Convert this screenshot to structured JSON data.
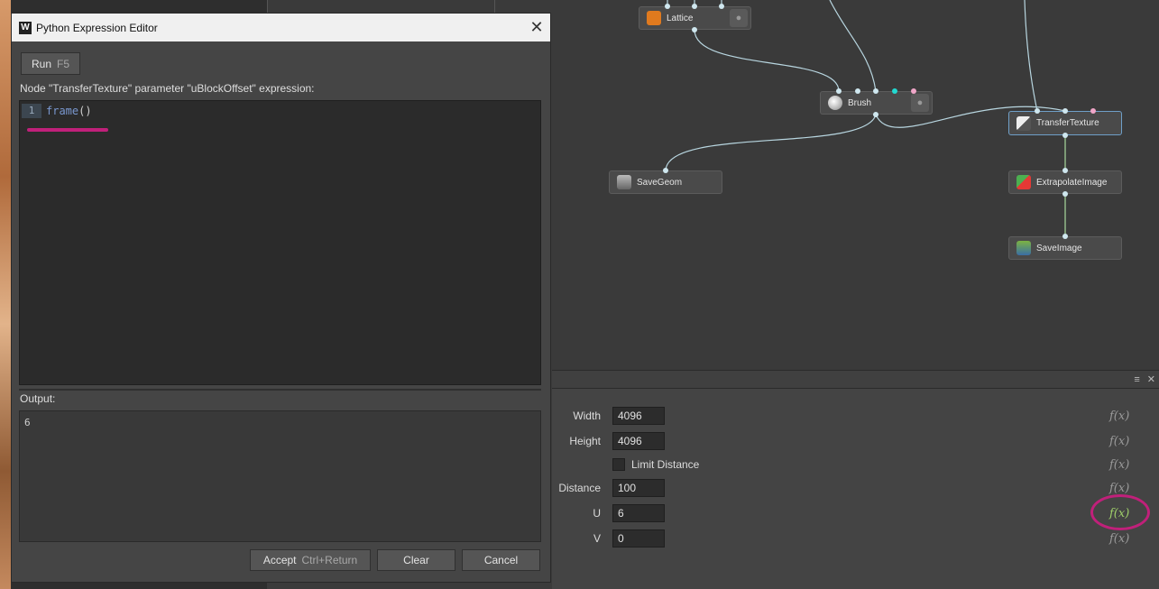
{
  "dialog": {
    "title": "Python Expression Editor",
    "close_glyph": "✕",
    "run_label": "Run",
    "run_shortcut": "F5",
    "expression_label": "Node \"TransferTexture\" parameter \"uBlockOffset\" expression:",
    "line_number": "1",
    "code_func": "frame",
    "code_paren": "()",
    "output_label": "Output:",
    "output_value": "6",
    "accept_label": "Accept",
    "accept_shortcut": "Ctrl+Return",
    "clear_label": "Clear",
    "cancel_label": "Cancel"
  },
  "graph": {
    "nodes": {
      "lattice": "Lattice",
      "brush": "Brush",
      "transfer_texture": "TransferTexture",
      "save_geom": "SaveGeom",
      "extrapolate_image": "ExtrapolateImage",
      "save_image": "SaveImage"
    },
    "bulb_icon": "lightbulb-icon"
  },
  "params": {
    "header_icons": [
      "menu-icon",
      "close-icon"
    ],
    "menu_glyph": "≡",
    "close_glyph": "✕",
    "fx_label": "f(x)",
    "width_label": "Width",
    "width_value": "4096",
    "height_label": "Height",
    "height_value": "4096",
    "limit_distance_label": "Limit Distance",
    "limit_distance_checked": false,
    "distance_label": "Distance",
    "distance_value": "100",
    "u_label": "U",
    "u_value": "6",
    "v_label": "V",
    "v_value": "0",
    "accent_color": "#c0207a",
    "active_fx_color": "#9fcf6a"
  }
}
